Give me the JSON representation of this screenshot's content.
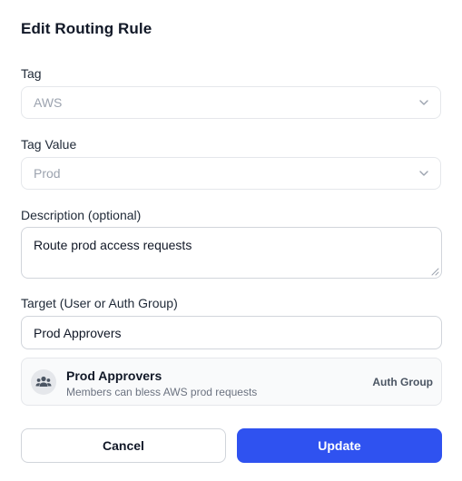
{
  "dialog": {
    "title": "Edit Routing Rule"
  },
  "fields": {
    "tag": {
      "label": "Tag",
      "value": "AWS"
    },
    "tag_value": {
      "label": "Tag Value",
      "value": "Prod"
    },
    "description": {
      "label": "Description (optional)",
      "value": "Route prod access requests"
    },
    "target": {
      "label": "Target (User or Auth Group)",
      "value": "Prod Approvers"
    }
  },
  "target_option": {
    "icon": "group-icon",
    "name": "Prod Approvers",
    "description": "Members can bless AWS prod requests",
    "kind": "Auth Group"
  },
  "buttons": {
    "cancel": "Cancel",
    "update": "Update"
  },
  "colors": {
    "primary": "#2f52f0",
    "border": "#d1d5db",
    "muted_text": "#9ca3af"
  }
}
